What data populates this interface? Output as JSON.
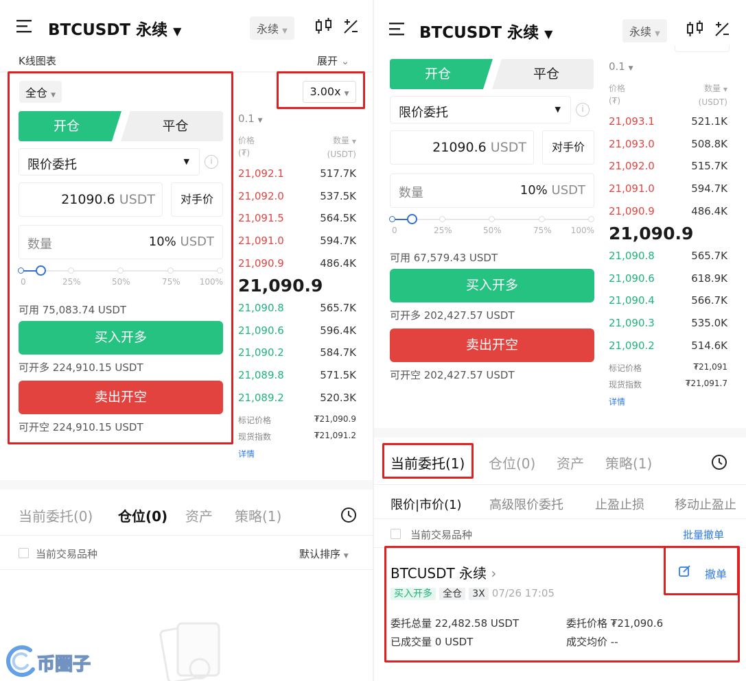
{
  "left": {
    "header": {
      "title": "BTCUSDT 永续",
      "contract_pill": "永续",
      "kline_label": "K线图表",
      "expand_label": "展开"
    },
    "margin_mode": "全仓",
    "leverage": "3.00x",
    "tabs": {
      "open": "开仓",
      "close": "平仓"
    },
    "order_type": "限价委托",
    "price_value": "21090.6",
    "price_unit": "USDT",
    "counterparty_btn": "对手价",
    "qty_placeholder": "数量",
    "qty_percent": "10%",
    "qty_unit": "USDT",
    "slider_labels": [
      "0",
      "25%",
      "50%",
      "75%",
      "100%"
    ],
    "slider_fraction": 0.1,
    "available": "可用 75,083.74 USDT",
    "buy_btn": "买入开多",
    "can_long": "可开多 224,910.15 USDT",
    "sell_btn": "卖出开空",
    "can_short": "可开空 224,910.15 USDT",
    "orderbook": {
      "depth": "0.1",
      "price_hdr": "价格",
      "price_unit": "(₮)",
      "qty_hdr": "数量",
      "qty_unit": "(USDT)",
      "asks": [
        {
          "price": "21,092.1",
          "qty": "517.7K"
        },
        {
          "price": "21,092.0",
          "qty": "537.5K"
        },
        {
          "price": "21,091.5",
          "qty": "564.5K"
        },
        {
          "price": "21,091.0",
          "qty": "594.7K"
        },
        {
          "price": "21,090.9",
          "qty": "486.4K"
        }
      ],
      "last": "21,090.9",
      "bids": [
        {
          "price": "21,090.8",
          "qty": "565.7K"
        },
        {
          "price": "21,090.6",
          "qty": "596.4K"
        },
        {
          "price": "21,090.2",
          "qty": "584.7K"
        },
        {
          "price": "21,089.8",
          "qty": "571.5K"
        },
        {
          "price": "21,089.2",
          "qty": "520.3K"
        }
      ],
      "mark_label": "标记价格",
      "mark_value": "₮21,090.9",
      "index_label": "现货指数",
      "index_value": "₮21,091.2",
      "details": "详情"
    },
    "bottom_tabs": [
      "当前委托(0)",
      "仓位(0)",
      "资产",
      "策略(1)"
    ],
    "current_symbol_label": "当前交易品种",
    "sort_label": "默认排序"
  },
  "right": {
    "header": {
      "title": "BTCUSDT 永续",
      "contract_pill": "永续"
    },
    "tabs": {
      "open": "开仓",
      "close": "平仓"
    },
    "order_type": "限价委托",
    "price_value": "21090.6",
    "price_unit": "USDT",
    "counterparty_btn": "对手价",
    "qty_placeholder": "数量",
    "qty_percent": "10%",
    "qty_unit": "USDT",
    "slider_labels": [
      "0",
      "25%",
      "50%",
      "75%",
      "100%"
    ],
    "slider_fraction": 0.1,
    "available": "可用 67,579.43 USDT",
    "buy_btn": "买入开多",
    "can_long": "可开多 202,427.57 USDT",
    "sell_btn": "卖出开空",
    "can_short": "可开空 202,427.57 USDT",
    "orderbook": {
      "depth": "0.1",
      "price_hdr": "价格",
      "price_unit": "(₮)",
      "qty_hdr": "数量",
      "qty_unit": "(USDT)",
      "asks": [
        {
          "price": "21,093.1",
          "qty": "521.1K"
        },
        {
          "price": "21,093.0",
          "qty": "508.8K"
        },
        {
          "price": "21,092.0",
          "qty": "515.7K"
        },
        {
          "price": "21,091.0",
          "qty": "594.7K"
        },
        {
          "price": "21,090.9",
          "qty": "486.4K"
        }
      ],
      "last": "21,090.9",
      "bids": [
        {
          "price": "21,090.8",
          "qty": "565.7K"
        },
        {
          "price": "21,090.6",
          "qty": "618.9K"
        },
        {
          "price": "21,090.4",
          "qty": "566.7K"
        },
        {
          "price": "21,090.3",
          "qty": "535.0K"
        },
        {
          "price": "21,090.2",
          "qty": "514.6K"
        }
      ],
      "mark_label": "标记价格",
      "mark_value": "₮21,091",
      "index_label": "现货指数",
      "index_value": "₮21,091.7",
      "details": "详情"
    },
    "bottom_tabs": [
      "当前委托(1)",
      "仓位(0)",
      "资产",
      "策略(1)"
    ],
    "sub_tabs": [
      "限价|市价(1)",
      "高级限价委托",
      "止盈止损",
      "移动止盈止"
    ],
    "current_symbol_label": "当前交易品种",
    "batch_cancel": "批量撤单",
    "order": {
      "symbol": "BTCUSDT 永续",
      "side": "买入开多",
      "mode": "全仓",
      "leverage": "3X",
      "time": "07/26 17:05",
      "cancel": "撤单",
      "total_label": "委托总量",
      "total_value": "22,482.58 USDT",
      "price_label": "委托价格",
      "price_value": "₮21,090.6",
      "filled_label": "已成交量",
      "filled_value": "0 USDT",
      "avg_label": "成交均价",
      "avg_value": "--"
    }
  },
  "watermark": "币圈子",
  "colors": {
    "green": "#26c281",
    "red": "#e2433f",
    "highlight": "#e02020"
  }
}
